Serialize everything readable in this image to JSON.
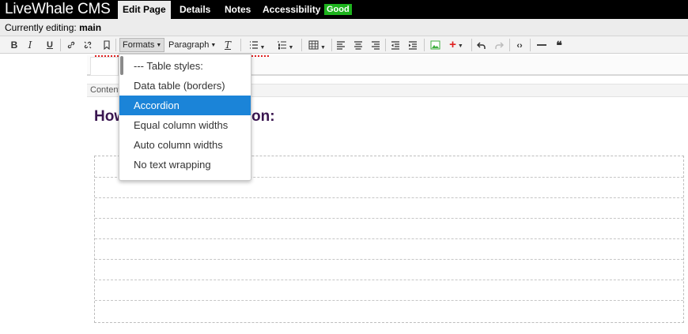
{
  "app": {
    "brand": "LiveWhale CMS",
    "tabs": [
      {
        "label": "Edit Page",
        "active": true
      },
      {
        "label": "Details",
        "active": false
      },
      {
        "label": "Notes",
        "active": false
      },
      {
        "label": "Accessibility",
        "active": false
      }
    ],
    "accessibility_badge": "Good",
    "badge_color": "#1db31d"
  },
  "editing": {
    "prefix": "Currently editing:",
    "region": "main"
  },
  "toolbar": {
    "bold": "B",
    "italic": "I",
    "underline": "U",
    "link_icon": "link-icon",
    "unlink_icon": "unlink-icon",
    "anchor_icon": "bookmark-icon",
    "formats_label": "Formats",
    "paragraph_label": "Paragraph",
    "clear_format": "T",
    "bullet_list_icon": "bullet-list-icon",
    "numbered_list_icon": "numbered-list-icon",
    "table_icon": "table-icon",
    "align_left_icon": "align-left-icon",
    "align_center_icon": "align-center-icon",
    "align_right_icon": "align-right-icon",
    "outdent_icon": "outdent-icon",
    "indent_icon": "indent-icon",
    "image_icon": "image-icon",
    "insert_icon": "plus-icon",
    "undo_icon": "undo-icon",
    "redo_icon": "redo-icon",
    "code_icon": "code-icon",
    "hr_icon": "horizontal-rule-icon",
    "quote_icon": "blockquote-icon",
    "insert_color": "#e02020",
    "image_color": "#3cae3c"
  },
  "editor": {
    "content_tag": "Content",
    "heading_start": "How",
    "heading_end": "on:"
  },
  "formats_menu": {
    "items": [
      {
        "label": "--- Table styles:",
        "active": false
      },
      {
        "label": "Data table (borders)",
        "active": false
      },
      {
        "label": "Accordion",
        "active": true
      },
      {
        "label": "Equal column widths",
        "active": false
      },
      {
        "label": "Auto column widths",
        "active": false
      },
      {
        "label": "No text wrapping",
        "active": false
      }
    ],
    "highlight_color": "#1b84d8"
  }
}
